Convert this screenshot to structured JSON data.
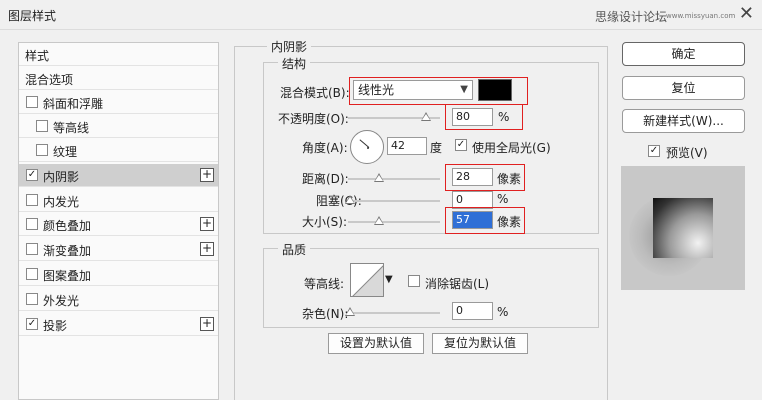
{
  "window": {
    "title": "图层样式",
    "watermark": "思缘设计论坛",
    "watermark_url": "www.missyuan.com"
  },
  "left_panel": {
    "items": [
      {
        "label": "样式",
        "checkbox": false
      },
      {
        "label": "混合选项",
        "checkbox": false
      },
      {
        "label": "斜面和浮雕",
        "checkbox": true,
        "checked": false
      },
      {
        "label": "等高线",
        "checkbox": true,
        "checked": false
      },
      {
        "label": "纹理",
        "checkbox": true,
        "checked": false
      },
      {
        "label": "内阴影",
        "checkbox": true,
        "checked": true,
        "selected": true,
        "plus": "+"
      },
      {
        "label": "内发光",
        "checkbox": true,
        "checked": false
      },
      {
        "label": "颜色叠加",
        "checkbox": true,
        "checked": false,
        "plus": "+"
      },
      {
        "label": "渐变叠加",
        "checkbox": true,
        "checked": false,
        "plus": "+"
      },
      {
        "label": "图案叠加",
        "checkbox": true,
        "checked": false
      },
      {
        "label": "外发光",
        "checkbox": true,
        "checked": false
      },
      {
        "label": "投影",
        "checkbox": true,
        "checked": true,
        "plus": "+"
      }
    ]
  },
  "inner_shadow": {
    "section_title": "内阴影",
    "structure": {
      "title": "结构",
      "blend_mode_label": "混合模式(B):",
      "blend_mode_value": "线性光",
      "color": "#000000",
      "opacity_label": "不透明度(O):",
      "opacity_value": "80",
      "opacity_unit": "%",
      "opacity_level": 0.8,
      "angle_label": "角度(A):",
      "angle_value": "42",
      "angle_unit": "度",
      "global_light_label": "使用全局光(G)",
      "global_light_checked": true,
      "distance_label": "距离(D):",
      "distance_value": "28",
      "distance_unit": "像素",
      "choke_label": "阻塞(C):",
      "choke_value": "0",
      "choke_unit": "%",
      "size_label": "大小(S):",
      "size_value": "57",
      "size_unit": "像素"
    },
    "quality": {
      "title": "品质",
      "contour_label": "等高线:",
      "antialias_label": "消除锯齿(L)",
      "antialias_checked": false,
      "noise_label": "杂色(N):",
      "noise_value": "0",
      "noise_unit": "%"
    },
    "make_default_label": "设置为默认值",
    "reset_default_label": "复位为默认值"
  },
  "actions": {
    "ok_label": "确定",
    "reset_label": "复位",
    "new_style_label": "新建样式(W)...",
    "preview_label": "预览(V)",
    "preview_checked": true
  },
  "icons": {
    "close": "close-icon",
    "check": "checkmark-icon",
    "plus": "plus-icon",
    "dropdown": "chevron-down-icon"
  }
}
